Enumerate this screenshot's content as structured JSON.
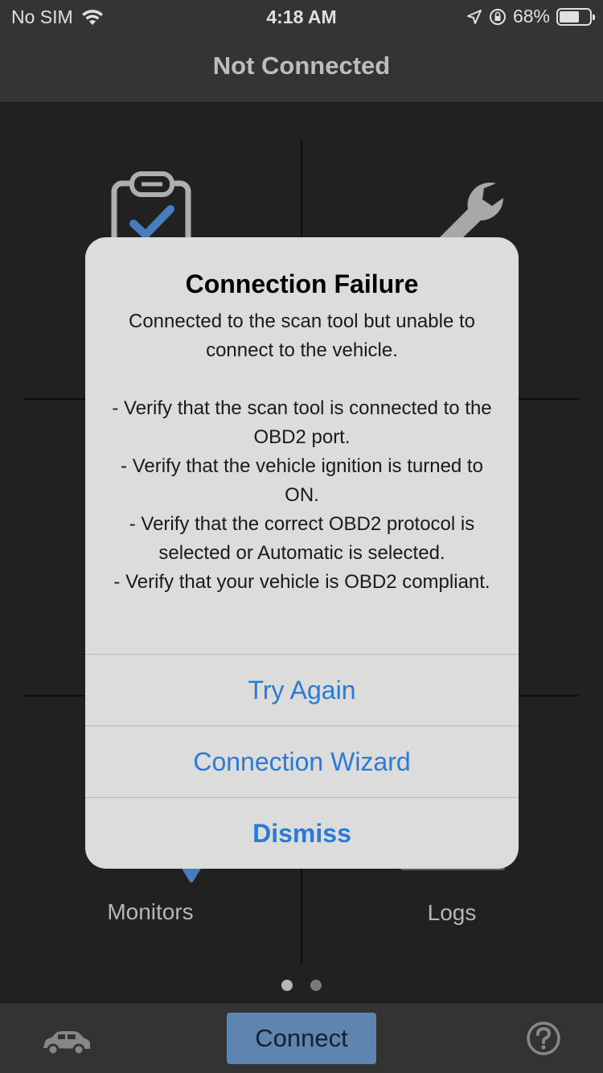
{
  "status_bar": {
    "carrier": "No SIM",
    "time": "4:18 AM",
    "battery": "68%",
    "battery_level": 0.68
  },
  "nav": {
    "title": "Not Connected"
  },
  "tiles": {
    "monitors_label": "Monitors",
    "logs_label": "Logs"
  },
  "pager": {
    "pages": 2,
    "current": 1
  },
  "tab_bar": {
    "connect_label": "Connect"
  },
  "alert": {
    "title": "Connection Failure",
    "message": "Connected to the scan tool but unable to connect to the vehicle.\n\n- Verify that the scan tool is connected to the OBD2 port.\n- Verify that the vehicle ignition is turned to ON.\n- Verify that the correct OBD2 protocol is selected or Automatic is selected.\n- Verify that your vehicle is OBD2 compliant.",
    "actions": {
      "try_again": "Try Again",
      "wizard": "Connection Wizard",
      "dismiss": "Dismiss"
    }
  },
  "colors": {
    "accent": "#2a7ad6",
    "connect_button": "#6a98c8"
  }
}
